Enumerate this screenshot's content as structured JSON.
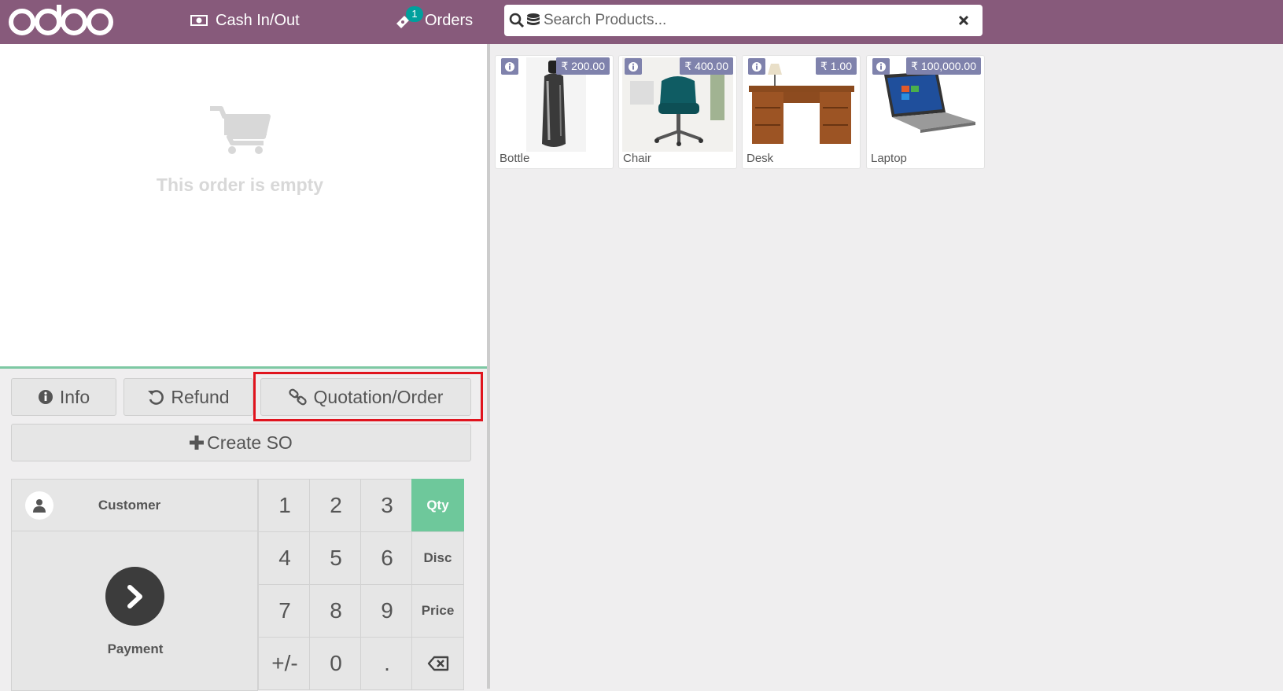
{
  "header": {
    "cash_label": "Cash In/Out",
    "orders_label": "Orders",
    "orders_count": "1",
    "search_placeholder": "Search Products..."
  },
  "order": {
    "empty_text": "This order is empty"
  },
  "controls": {
    "info_label": "Info",
    "refund_label": "Refund",
    "quotation_label": "Quotation/Order",
    "create_so_label": "Create SO"
  },
  "keypad": {
    "customer_label": "Customer",
    "payment_label": "Payment",
    "keys": [
      "1",
      "2",
      "3",
      "4",
      "5",
      "6",
      "7",
      "8",
      "9",
      "+/-",
      "0",
      "."
    ],
    "modes": [
      "Qty",
      "Disc",
      "Price"
    ],
    "active_mode": "Qty"
  },
  "products": [
    {
      "name": "Bottle",
      "price": "₹ 200.00"
    },
    {
      "name": "Chair",
      "price": "₹ 400.00"
    },
    {
      "name": "Desk",
      "price": "₹ 1.00"
    },
    {
      "name": "Laptop",
      "price": "₹ 100,000.00"
    }
  ],
  "colors": {
    "brand": "#875a7b",
    "accent": "#6ec89b",
    "badge": "#00a09d",
    "price_tag": "#7f82ac",
    "highlight": "#e0141e"
  }
}
